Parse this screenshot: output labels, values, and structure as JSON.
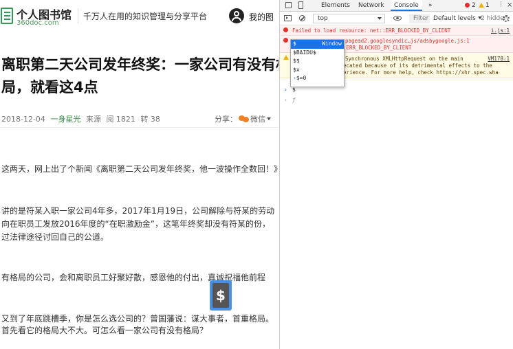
{
  "article_page": {
    "site": {
      "name": "个人图书馆",
      "domain": "360doc.com",
      "slogan": "千万人在用的知识管理与分享平台",
      "my_library": "我的图"
    },
    "title": "离职第二天公司发年终奖：一家公司有没有格局，就看这4点",
    "meta": {
      "date": "2018-12-04",
      "author": "一身星光",
      "source_label": "来源",
      "reads": "阅 1821",
      "reposts": "转 38"
    },
    "share": {
      "label": "分享：",
      "channel": "微信"
    },
    "paragraphs": [
      "这两天，网上出了个新闻《离职第二天公司发年终奖，他一波操作全数回！》",
      "讲的是符某入职一家公司4年多，2017年1月19日，公司解除与符某的劳动",
      "向在职员工发放2016年度的“在职激励金”，这笔年终奖却没有符某的份，",
      "过法律途径讨回自己的公道。",
      "有格局的公司，会和离职员工好聚好散，感恩他的付出，真诚祝福他前程",
      "又到了年底跳槽季，你是怎么选公司的？曾国藩说：谋大事者，首重格局。",
      "首先看它的格局大不大。可怎么看一家公司有没有格局？"
    ],
    "badge_symbol": "$"
  },
  "devtools": {
    "tabs": [
      "Elements",
      "Network",
      "Console"
    ],
    "more_tabs": "»",
    "error_count": "2",
    "warning_count": "1",
    "toolbar": {
      "context": "top",
      "filter_placeholder": "Filter",
      "levels": "Default levels",
      "hidden": "2 hidden"
    },
    "messages": [
      {
        "level": "error",
        "text": "Failed to load resource: net::ERR_BLOCKED_BY_CLIENT",
        "source": "i.js:1"
      },
      {
        "level": "error",
        "text": "o     pagead2.googlesyndic…js/adsbygoogle.js:1",
        "source": "",
        "line2": ":ERR_BLOCKED_BY_CLIENT"
      },
      {
        "level": "warning",
        "text": "] Synchronous XMLHttpRequest on the main",
        "source": "VM178:1",
        "line2": "ecated because of its detrimental effects to the",
        "line3": "erience. For more help, check https://xhr.spec.wha"
      }
    ],
    "autocomplete": [
      {
        "label": "$",
        "hint": "Window",
        "selected": true
      },
      {
        "label": "$BAIDU$",
        "hint": "",
        "selected": false
      },
      {
        "label": "$$",
        "hint": "",
        "selected": false
      },
      {
        "label": "$x",
        "hint": "",
        "selected": false
      },
      {
        "label": "$=0",
        "hint": "",
        "selected": false,
        "prefix": "›"
      }
    ],
    "input": {
      "prompt": "›",
      "value": "$"
    },
    "output": {
      "arrow": "‹",
      "value": "ƒ"
    }
  }
}
